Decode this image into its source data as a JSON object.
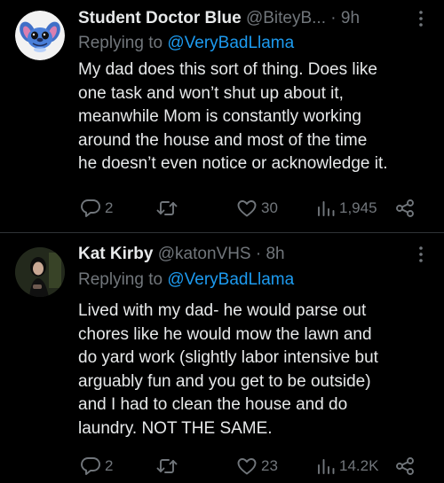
{
  "tweets": [
    {
      "display_name": "Student Doctor Blue",
      "handle": "@BiteyB...",
      "separator": "·",
      "time": "9h",
      "replying_prefix": "Replying to",
      "replying_to": "@VeryBadLlama",
      "body_lines": [
        "My dad does this sort of thing. Does like",
        "one task and won’t shut up about it,",
        "meanwhile Mom is constantly working",
        "around the house and most of the time",
        "he doesn’t even notice or acknowledge it."
      ],
      "replies": "2",
      "retweets": "",
      "likes": "30",
      "views": "1,945",
      "avatar_icon": "stitch-avatar"
    },
    {
      "display_name": "Kat Kirby",
      "handle": "@katonVHS",
      "separator": "·",
      "time": "8h",
      "replying_prefix": "Replying to",
      "replying_to": "@VeryBadLlama",
      "body_lines": [
        "Lived with my dad- he would parse out",
        "chores like he would mow the lawn and",
        "do yard work (slightly labor intensive but",
        "arguably fun and you get to be outside)",
        "and I had to clean the house and do",
        "laundry. NOT THE SAME."
      ],
      "replies": "2",
      "retweets": "",
      "likes": "23",
      "views": "14.2K",
      "avatar_icon": "photo-avatar"
    }
  ],
  "colors": {
    "background": "#000000",
    "text": "#e7e9ea",
    "muted": "#71767b",
    "link": "#1d9bf0",
    "divider": "#2f3336"
  }
}
